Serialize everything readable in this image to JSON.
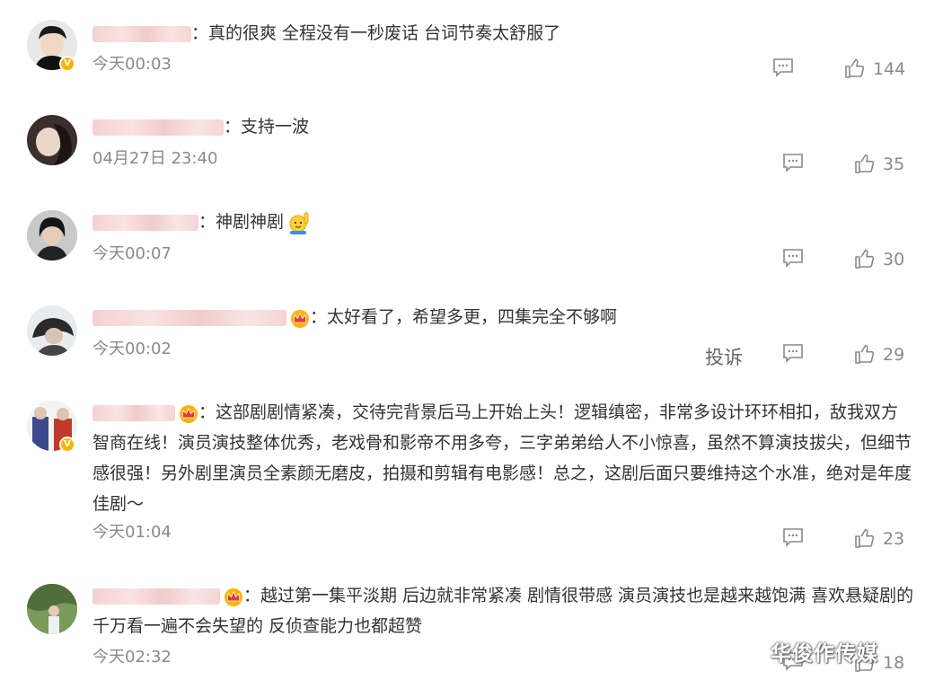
{
  "comments": [
    {
      "separator": "：",
      "text": "真的很爽 全程没有一秒废话 台词节奏太舒服了",
      "time": "今天00:03",
      "likes": "144",
      "verified": true
    },
    {
      "separator": "：",
      "text": "支持一波",
      "time": "04月27日 23:40",
      "likes": "35",
      "verified": false
    },
    {
      "separator": "：",
      "text": "神剧神剧",
      "time": "今天00:07",
      "likes": "30",
      "verified": false
    },
    {
      "separator": "：",
      "text": "太好看了，希望多更，四集完全不够啊",
      "time": "今天00:02",
      "likes": "29",
      "verified": false,
      "report_label": "投诉"
    },
    {
      "separator": "：",
      "text": "这部剧剧情紧凑，交待完背景后马上开始上头！逻辑缜密，非常多设计环环相扣，敌我双方智商在线！演员演技整体优秀，老戏骨和影帝不用多夸，三字弟弟给人不小惊喜，虽然不算演技拔尖，但细节感很强！另外剧里演员全素颜无磨皮，拍摄和剪辑有电影感！总之，这剧后面只要维持这个水准，绝对是年度佳剧～",
      "time": "今天01:04",
      "likes": "23",
      "verified": true
    },
    {
      "separator": "：",
      "text": "越过第一集平淡期 后边就非常紧凑 剧情很带感 演员演技也是越来越饱满 喜欢悬疑剧的千万看一遍不会失望的 反侦查能力也都超赞",
      "time": "今天02:32",
      "likes": "18",
      "verified": false
    }
  ],
  "icons": {
    "reply": "comment-icon",
    "like": "thumbs-up-icon",
    "crown": "crown-badge-icon",
    "verified": "verified-v-icon",
    "emoji": "raising-hand-emoji-icon"
  },
  "colors": {
    "text": "#333333",
    "meta": "#8a8a8a",
    "verified_badge": "#f7b500"
  },
  "watermark": "华俊作传媒"
}
